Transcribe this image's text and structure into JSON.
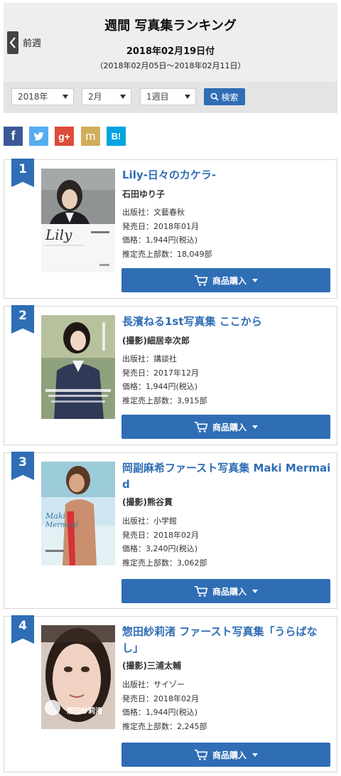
{
  "header": {
    "prev_label": "前週",
    "title": "週間 写真集ランキング",
    "date": "2018年02月19日付",
    "range": "（2018年02月05日～2018年02月11日）"
  },
  "filters": {
    "year": "2018年",
    "month": "2月",
    "week": "1週目",
    "search_label": "検索"
  },
  "social": {
    "facebook": "f",
    "twitter": "twitter-bird",
    "googleplus": "g+",
    "mixi": "m",
    "hatena": "B!"
  },
  "colors": {
    "accent": "#2f6db5",
    "facebook": "#3b5998",
    "twitter": "#55acee",
    "googleplus": "#dd4b39",
    "mixi": "#d1ad59",
    "hatena": "#00a4de"
  },
  "buy_label": "商品購入",
  "items": [
    {
      "rank": "1",
      "title": "Lily-日々のカケラ-",
      "author": "石田ゆり子",
      "publisher": "出版社：文藝春秋",
      "release": "発売日：2018年01月",
      "price": "価格：1,944円(税込)",
      "sales": "推定売上部数：18,049部"
    },
    {
      "rank": "2",
      "title": "長濱ねる1st写真集 ここから",
      "author": "(撮影)細居幸次郎",
      "publisher": "出版社：講談社",
      "release": "発売日：2017年12月",
      "price": "価格：1,944円(税込)",
      "sales": "推定売上部数：3,915部"
    },
    {
      "rank": "3",
      "title": "岡副麻希ファースト写真集 Maki Mermaid",
      "author": "(撮影)熊谷貫",
      "publisher": "出版社：小学館",
      "release": "発売日：2018年02月",
      "price": "価格：3,240円(税込)",
      "sales": "推定売上部数：3,062部"
    },
    {
      "rank": "4",
      "title": "惣田紗莉渚 ファースト写真集「うらばなし」",
      "author": "(撮影)三浦太輔",
      "publisher": "出版社：サイゾー",
      "release": "発売日：2018年02月",
      "price": "価格：1,944円(税込)",
      "sales": "推定売上部数：2,245部"
    }
  ]
}
